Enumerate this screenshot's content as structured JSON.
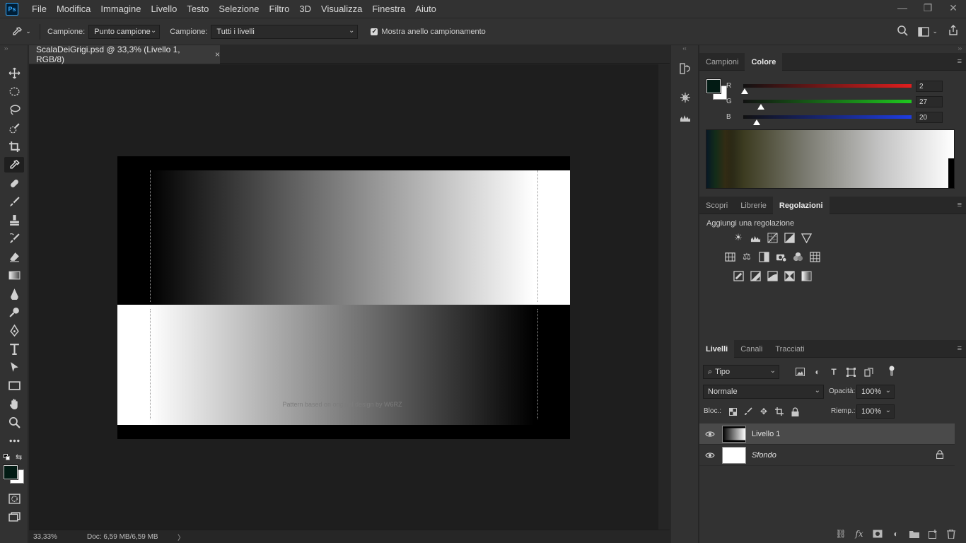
{
  "app": {
    "logo_text": "Ps"
  },
  "menu": [
    "File",
    "Modifica",
    "Immagine",
    "Livello",
    "Testo",
    "Selezione",
    "Filtro",
    "3D",
    "Visualizza",
    "Finestra",
    "Aiuto"
  ],
  "window_controls": {
    "minimize": "—",
    "restore": "❐",
    "close": "✕"
  },
  "options_bar": {
    "sample_size_label": "Campione:",
    "sample_size_value": "Punto campione",
    "sample_label": "Campione:",
    "sample_value": "Tutti i livelli",
    "show_ring_checked": true,
    "show_ring_label": "Mostra anello campionamento"
  },
  "document": {
    "tab_title": "ScalaDeiGrigi.psd @ 33,3% (Livello 1, RGB/8)",
    "close_glyph": "×",
    "credit_text": "Pattern based on original design by W6RZ"
  },
  "status": {
    "zoom": "33,33%",
    "doc_size": "Doc: 6,59 MB/6,59 MB",
    "arrow": "〉"
  },
  "color_panel": {
    "tabs": [
      {
        "label": "Campioni",
        "active": false
      },
      {
        "label": "Colore",
        "active": true
      }
    ],
    "foreground_color": "#021b14",
    "background_color": "#ffffff",
    "channels": [
      {
        "label": "R",
        "value": "2",
        "fraction": 0.008,
        "track_color": "#e01e1e"
      },
      {
        "label": "G",
        "value": "27",
        "fraction": 0.106,
        "track_color": "#1ec81e"
      },
      {
        "label": "B",
        "value": "20",
        "fraction": 0.078,
        "track_color": "#1e3ce0"
      }
    ]
  },
  "adjustments_panel": {
    "tabs": [
      {
        "label": "Scopri",
        "active": false
      },
      {
        "label": "Librerie",
        "active": false
      },
      {
        "label": "Regolazioni",
        "active": true
      }
    ],
    "title": "Aggiungi una regolazione",
    "rows": [
      [
        "brightness-contrast-icon",
        "levels-icon",
        "curves-icon",
        "exposure-icon",
        "vibrance-icon"
      ],
      [
        "hue-saturation-icon",
        "color-balance-icon",
        "black-white-icon",
        "photo-filter-icon",
        "channel-mixer-icon",
        "color-lookup-icon"
      ],
      [
        "invert-icon",
        "posterize-icon",
        "threshold-icon",
        "selective-color-icon",
        "gradient-map-icon"
      ]
    ]
  },
  "layers_panel": {
    "tabs": [
      {
        "label": "Livelli",
        "active": true
      },
      {
        "label": "Canali",
        "active": false
      },
      {
        "label": "Tracciati",
        "active": false
      }
    ],
    "filter_type": "Tipo",
    "blend_mode": "Normale",
    "opacity_label": "Opacità:",
    "opacity_value": "100%",
    "lock_label": "Bloc.:",
    "fill_label": "Riemp.:",
    "fill_value": "100%",
    "layers": [
      {
        "name": "Livello 1",
        "selected": true,
        "locked": false,
        "thumb": "gradient"
      },
      {
        "name": "Sfondo",
        "selected": false,
        "locked": true,
        "thumb": "white"
      }
    ]
  }
}
